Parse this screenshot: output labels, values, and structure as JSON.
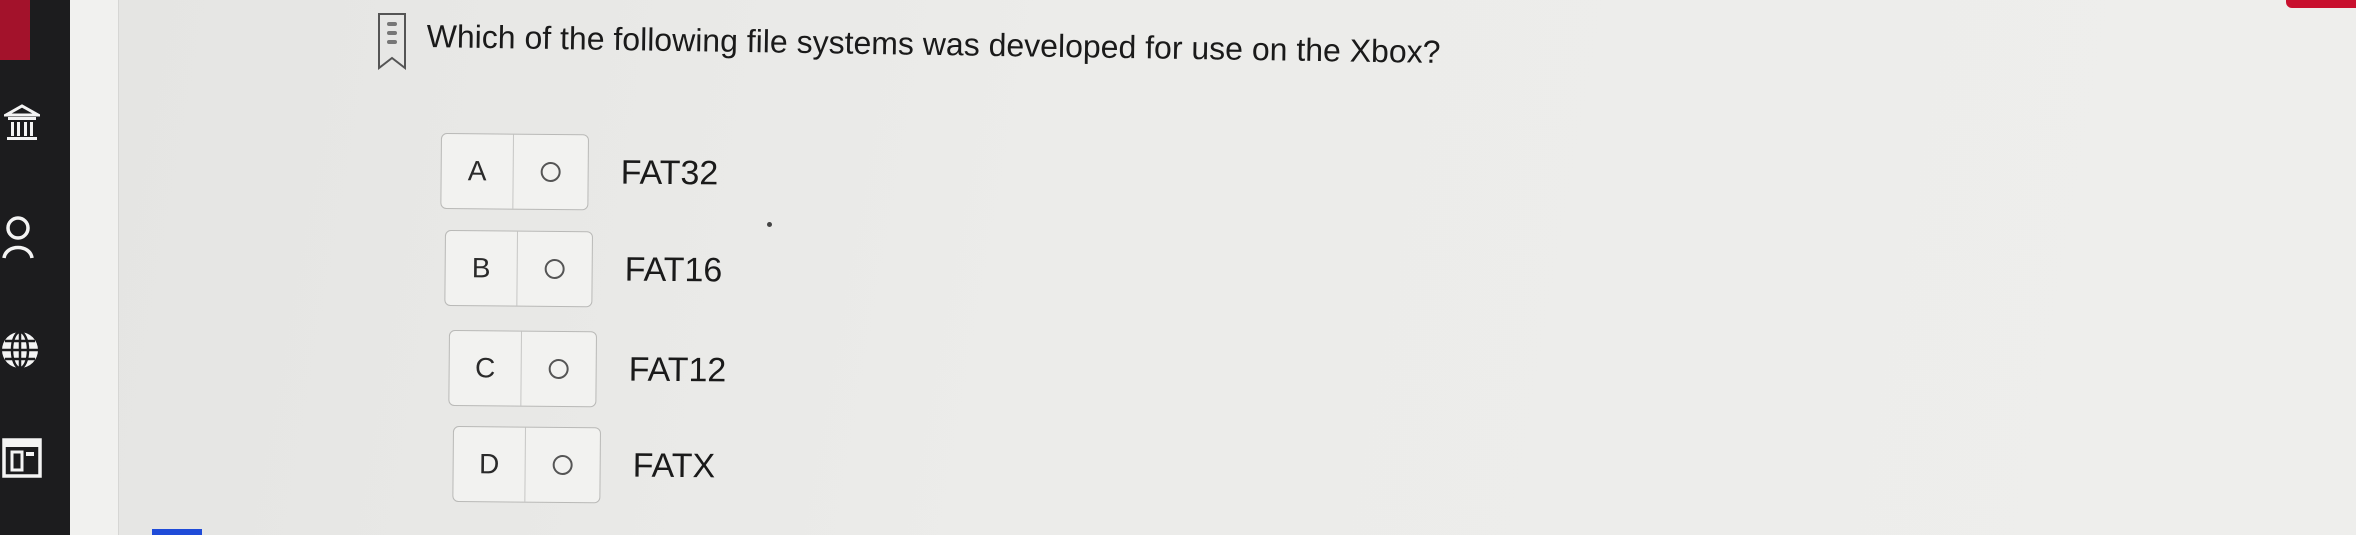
{
  "question": {
    "text": "Which of the following file systems was developed for use on the Xbox?"
  },
  "options": [
    {
      "letter": "A",
      "text": "FAT32"
    },
    {
      "letter": "B",
      "text": "FAT16"
    },
    {
      "letter": "C",
      "text": "FAT12"
    },
    {
      "letter": "D",
      "text": "FATX"
    }
  ],
  "sidebar": {
    "icons": [
      "institution-icon",
      "user-icon",
      "globe-icon",
      "calendar-icon"
    ]
  },
  "colors": {
    "rail": "#1c1c1e",
    "accent_red": "#c8102e",
    "accent_blue": "#1f4bd8"
  }
}
